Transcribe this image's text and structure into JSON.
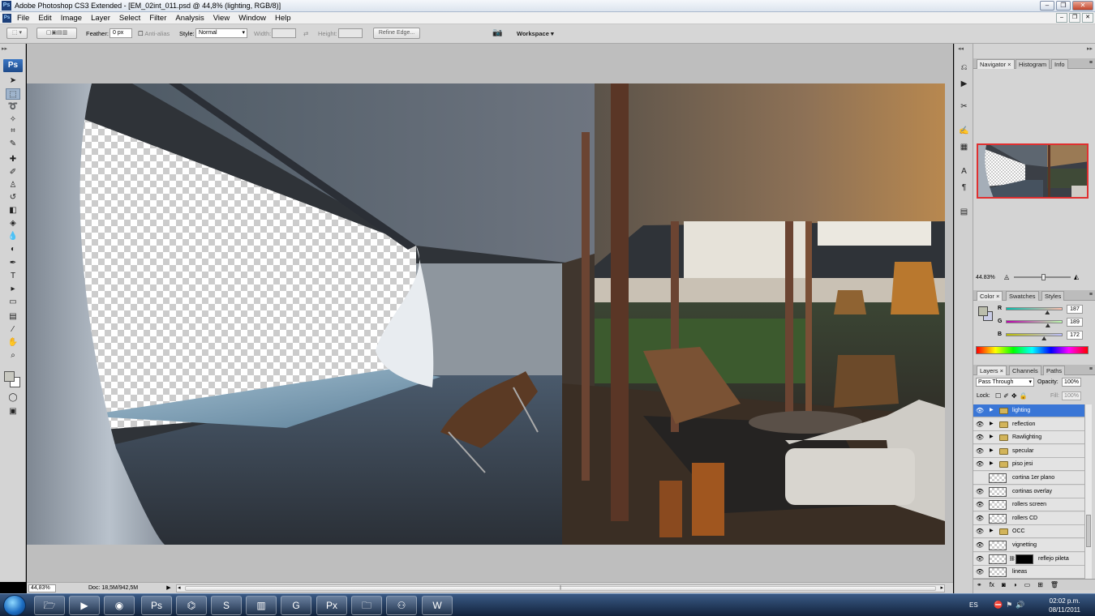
{
  "window": {
    "title": "Adobe Photoshop CS3 Extended - [EM_02int_011.psd @ 44,8% (lighting, RGB/8)]",
    "app_badge": "Ps",
    "minimize": "–",
    "restore": "❐",
    "close": "✕"
  },
  "menu": {
    "items": [
      "File",
      "Edit",
      "Image",
      "Layer",
      "Select",
      "Filter",
      "Analysis",
      "View",
      "Window",
      "Help"
    ],
    "doc_badge": "Ps",
    "doc_min": "–",
    "doc_restore": "❐",
    "doc_close": "✕"
  },
  "options": {
    "feather_label": "Feather:",
    "feather_value": "0 px",
    "antialias_label": "Anti-alias",
    "style_label": "Style:",
    "style_value": "Normal",
    "width_label": "Width:",
    "height_label": "Height:",
    "refine_edge": "Refine Edge...",
    "workspace_label": "Workspace ▾"
  },
  "toolbox": {
    "logo": "Ps",
    "tools": [
      {
        "name": "move-tool",
        "glyph": "➤"
      },
      {
        "name": "marquee-tool",
        "glyph": "⬚",
        "selected": true
      },
      {
        "name": "lasso-tool",
        "glyph": "➰"
      },
      {
        "name": "magic-wand-tool",
        "glyph": "✧"
      },
      {
        "name": "crop-tool",
        "glyph": "⌗"
      },
      {
        "name": "slice-tool",
        "glyph": "✎"
      },
      {
        "name": "healing-brush-tool",
        "glyph": "✚"
      },
      {
        "name": "brush-tool",
        "glyph": "✐"
      },
      {
        "name": "clone-stamp-tool",
        "glyph": "♙"
      },
      {
        "name": "history-brush-tool",
        "glyph": "↺"
      },
      {
        "name": "eraser-tool",
        "glyph": "◧"
      },
      {
        "name": "paint-bucket-tool",
        "glyph": "◈"
      },
      {
        "name": "blur-tool",
        "glyph": "💧"
      },
      {
        "name": "dodge-tool",
        "glyph": "◐"
      },
      {
        "name": "pen-tool",
        "glyph": "✒"
      },
      {
        "name": "type-tool",
        "glyph": "T"
      },
      {
        "name": "path-selection-tool",
        "glyph": "▸"
      },
      {
        "name": "shape-tool",
        "glyph": "▭"
      },
      {
        "name": "notes-tool",
        "glyph": "▤"
      },
      {
        "name": "eyedropper-tool",
        "glyph": "⁄"
      },
      {
        "name": "hand-tool",
        "glyph": "✋"
      },
      {
        "name": "zoom-tool",
        "glyph": "⌕"
      }
    ],
    "quickmask": "◯",
    "screenmode": "▣"
  },
  "status": {
    "zoom": "44,83%",
    "doc": "Doc: 18,5M/942,5M",
    "arrow": "▶",
    "scroll_left": "◂",
    "scroll_right": "▸",
    "scroll_grip": "⫼"
  },
  "dock": {
    "icons": [
      {
        "name": "history-icon",
        "glyph": "⎌"
      },
      {
        "name": "actions-icon",
        "glyph": "▶"
      },
      {
        "name": "tools-presets-icon",
        "glyph": "✂"
      },
      {
        "name": "brushes-icon",
        "glyph": "✍"
      },
      {
        "name": "clone-source-icon",
        "glyph": "▦"
      },
      {
        "name": "character-icon",
        "glyph": "A"
      },
      {
        "name": "paragraph-icon",
        "glyph": "¶"
      },
      {
        "name": "notes-panel-icon",
        "glyph": "▤"
      }
    ]
  },
  "navigator": {
    "tabs": [
      "Navigator ×",
      "Histogram",
      "Info"
    ],
    "zoom": "44.83%",
    "zoom_out": "◬",
    "zoom_in": "◭"
  },
  "color": {
    "tabs": [
      "Color ×",
      "Swatches",
      "Styles"
    ],
    "r_label": "R",
    "r": "187",
    "g_label": "G",
    "g": "189",
    "b_label": "B",
    "b": "172",
    "fg_hex": "#bbbdac"
  },
  "layers": {
    "tabs": [
      "Layers ×",
      "Channels",
      "Paths"
    ],
    "blend": "Pass Through",
    "opacity_label": "Opacity:",
    "opacity": "100%",
    "lock_label": "Lock:",
    "fill_label": "Fill:",
    "fill": "100%",
    "rows": [
      {
        "name": "lighting",
        "type": "group",
        "visible": true,
        "selected": true
      },
      {
        "name": "reflection",
        "type": "group",
        "visible": true
      },
      {
        "name": "Rawlighting",
        "type": "group",
        "visible": true
      },
      {
        "name": "specular",
        "type": "group",
        "visible": true
      },
      {
        "name": "piso jesi",
        "type": "group",
        "visible": true
      },
      {
        "name": "cortina 1er plano",
        "type": "layer",
        "visible": false
      },
      {
        "name": "cortinas overlay",
        "type": "layer",
        "visible": true
      },
      {
        "name": "rollers screen",
        "type": "layer",
        "visible": true
      },
      {
        "name": "rollers CD",
        "type": "layer",
        "visible": true
      },
      {
        "name": "OCC",
        "type": "group",
        "visible": true
      },
      {
        "name": "vignetting",
        "type": "layer",
        "visible": true
      },
      {
        "name": "reflejo pileta",
        "type": "masked",
        "visible": true
      },
      {
        "name": "lineas",
        "type": "layer",
        "visible": true
      }
    ],
    "footer": [
      "⚭",
      "fx",
      "◙",
      "◑",
      "▭",
      "⊞",
      "🗑"
    ]
  },
  "taskbar": {
    "items": [
      {
        "name": "explorer-taskbar-button",
        "glyph": "🗁"
      },
      {
        "name": "media-player-taskbar-button",
        "glyph": "▶"
      },
      {
        "name": "firefox-taskbar-button",
        "glyph": "◉"
      },
      {
        "name": "photoshop-taskbar-button",
        "glyph": "Ps"
      },
      {
        "name": "sketchup-taskbar-button",
        "glyph": "⌬"
      },
      {
        "name": "skype-taskbar-button",
        "glyph": "S"
      },
      {
        "name": "winrar-taskbar-button",
        "glyph": "▥"
      },
      {
        "name": "app-g-taskbar-button",
        "glyph": "G"
      },
      {
        "name": "px-taskbar-button",
        "glyph": "Px"
      },
      {
        "name": "folder-taskbar-button",
        "glyph": "🗀"
      },
      {
        "name": "network-taskbar-button",
        "glyph": "⚇"
      },
      {
        "name": "word-taskbar-button",
        "glyph": "W"
      }
    ],
    "lang": "ES",
    "time": "02:02 p.m.",
    "date": "08/11/2011"
  }
}
